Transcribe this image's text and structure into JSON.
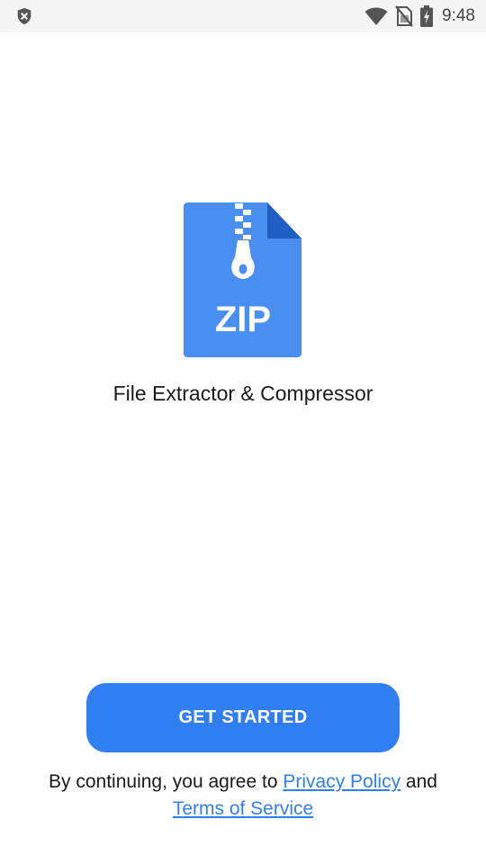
{
  "status_bar": {
    "time": "9:48",
    "icons": [
      "shield-icon",
      "wifi-icon",
      "no-sim-icon",
      "battery-charging-icon"
    ]
  },
  "app": {
    "logo_text": "ZIP",
    "name": "File Extractor & Compressor"
  },
  "actions": {
    "get_started_label": "GET STARTED"
  },
  "terms": {
    "prefix": "By continuing, you agree to",
    "privacy_link": "Privacy Policy",
    "conjunction": "and",
    "terms_link": "Terms of Service"
  },
  "colors": {
    "accent": "#2f7ff2",
    "logo_body": "#4a8ff0",
    "logo_fold": "#1f5fc4",
    "status_bar_bg": "#f5f5f5"
  }
}
